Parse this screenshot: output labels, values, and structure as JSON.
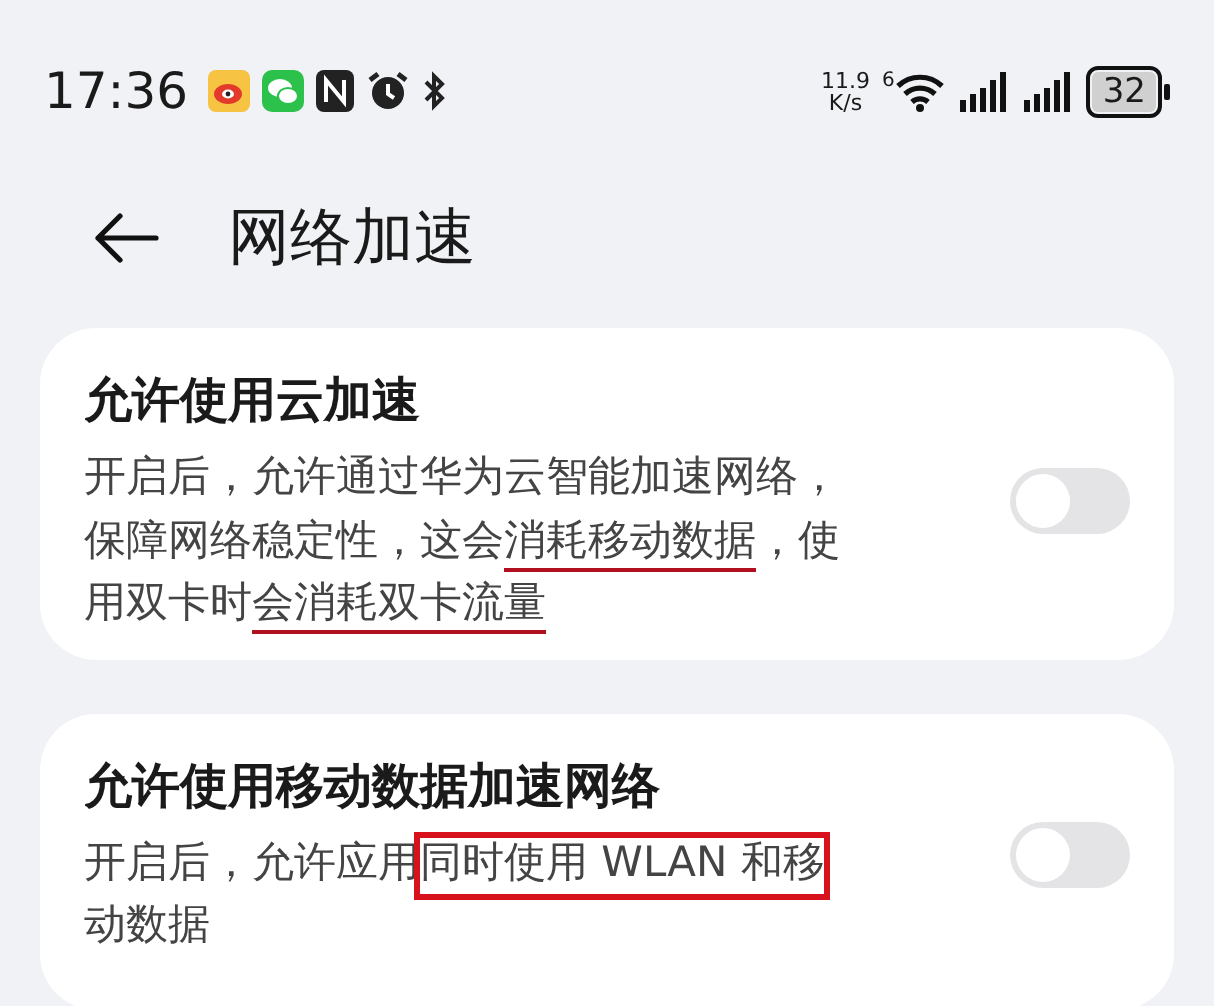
{
  "status_bar": {
    "time": "17:36",
    "net_speed": "11.9",
    "net_speed_unit": "K/s",
    "wifi_generation": "6",
    "battery": "32"
  },
  "header": {
    "title": "网络加速"
  },
  "settings": [
    {
      "title": "允许使用云加速",
      "description": [
        {
          "text": "开启后，允许通过华为云智能加速网络，保障网络稳定性，这会",
          "underlined": false,
          "boxed": false
        },
        {
          "text": "消耗移动数据",
          "underlined": true,
          "boxed": false
        },
        {
          "text": "，使用双卡时",
          "underlined": false,
          "boxed": false
        },
        {
          "text": "会消耗双卡流量",
          "underlined": true,
          "boxed": false
        }
      ],
      "on": false
    },
    {
      "title": "允许使用移动数据加速网络",
      "description": [
        {
          "text": "开启后，允许应用",
          "underlined": false,
          "boxed": false
        },
        {
          "text": "同时使用 WLAN 和移",
          "underlined": false,
          "boxed": true
        },
        {
          "text": "动数据",
          "underlined": false,
          "boxed": false
        }
      ],
      "on": false
    }
  ]
}
